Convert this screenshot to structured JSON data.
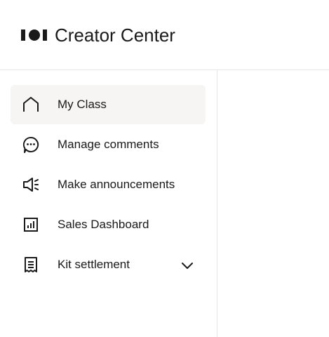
{
  "header": {
    "brand_logo": "101-logo-icon",
    "brand_title": "Creator Center"
  },
  "sidebar": {
    "items": [
      {
        "label": "My Class",
        "icon": "home-icon",
        "active": true
      },
      {
        "label": "Manage comments",
        "icon": "comment-icon",
        "active": false
      },
      {
        "label": "Make announcements",
        "icon": "megaphone-icon",
        "active": false
      },
      {
        "label": "Sales Dashboard",
        "icon": "bar-chart-icon",
        "active": false
      },
      {
        "label": "Kit settlement",
        "icon": "receipt-icon",
        "active": false,
        "expandable": true,
        "expanded": false
      }
    ]
  },
  "colors": {
    "active_bg": "#f6f5f3",
    "divider": "#e6e6e6",
    "text": "#1a1a1a"
  }
}
